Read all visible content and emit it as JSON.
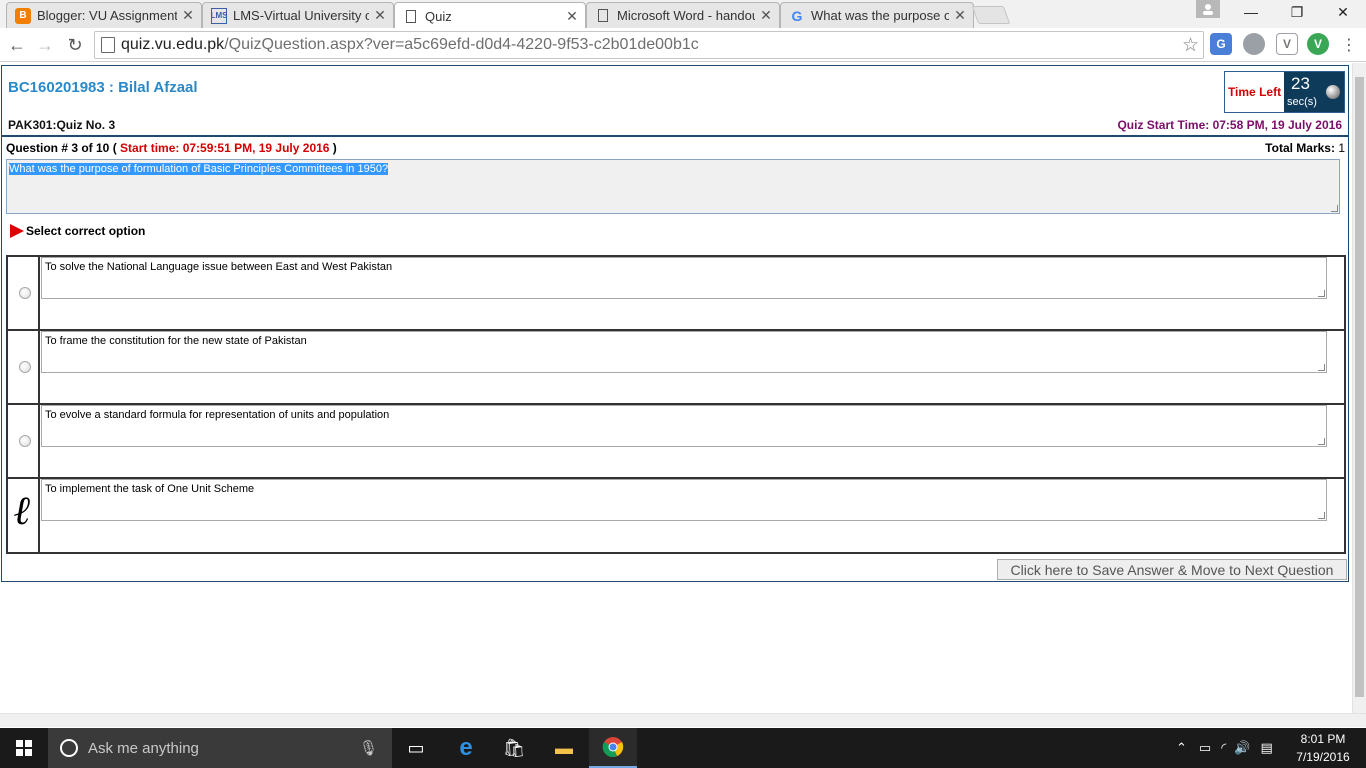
{
  "browser": {
    "tabs": [
      {
        "favicon": "blogger-icon",
        "title": "Blogger: VU Assignments"
      },
      {
        "favicon": "lms-icon",
        "title": "LMS-Virtual University of Pakistan"
      },
      {
        "favicon": "page-icon",
        "title": "Quiz"
      },
      {
        "favicon": "page-icon",
        "title": "Microsoft Word - handout"
      },
      {
        "favicon": "google-icon",
        "title": "What was the purpose of formulation"
      }
    ],
    "active_tab": 2,
    "url_host": "quiz.vu.edu.pk",
    "url_path": "/QuizQuestion.aspx?ver=a5c69efd-d0d4-4220-9f53-c2b01de00b1c"
  },
  "quiz": {
    "student": "BC160201983 : Bilal Afzaal",
    "timer": {
      "label": "Time Left",
      "value": "23",
      "unit": "sec(s)"
    },
    "quiz_name": "PAK301:Quiz No. 3",
    "quiz_start": "Quiz Start Time: 07:58 PM, 19 July 2016",
    "question_number": "Question # 3 of 10",
    "question_start": "Start time: 07:59:51 PM, 19 July 2016",
    "total_marks_label": "Total Marks:",
    "total_marks": "1",
    "question_text": "What was the purpose of formulation of Basic Principles Committees in 1950?",
    "select_label": "Select correct option",
    "options": [
      "To solve the National Language issue between East and West Pakistan",
      "To frame the constitution for the new state of Pakistan",
      "To evolve a standard formula for representation of units and population",
      "To implement the task of One Unit Scheme"
    ],
    "save_button": "Click here to Save Answer & Move to Next Question"
  },
  "taskbar": {
    "search_placeholder": "Ask me anything",
    "time": "8:01 PM",
    "date": "7/19/2016"
  },
  "colors": {
    "accent_blue": "#2a89c8",
    "timer_bg": "#0f3b5b",
    "red": "#d40000",
    "purple": "#7a0f6a"
  }
}
